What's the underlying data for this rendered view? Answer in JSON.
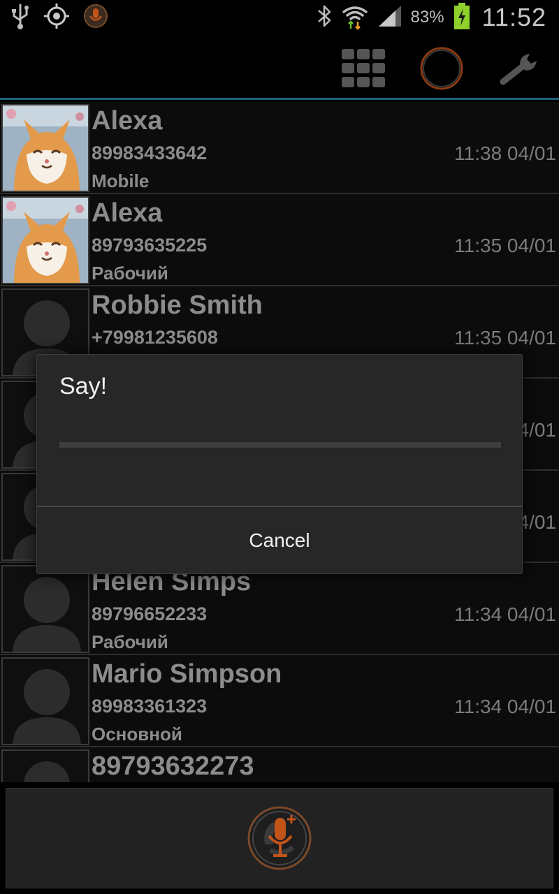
{
  "status_bar": {
    "battery_percent": "83%",
    "time": "11:52",
    "icons": [
      "usb-icon",
      "gps-icon",
      "app-notification-icon",
      "bluetooth-icon",
      "wifi-icon",
      "signal-icon",
      "battery-icon"
    ],
    "battery_level": 0.83
  },
  "action_bar": {
    "icons": [
      "dialpad-grid-icon",
      "ring-circle-icon",
      "wrench-settings-icon"
    ]
  },
  "calls": [
    {
      "name": "Alexa",
      "number": "89983433642",
      "time": "11:38 04/01",
      "type": "Mobile",
      "avatar": "cat-photo"
    },
    {
      "name": "Alexa",
      "number": "89793635225",
      "time": "11:35 04/01",
      "type": "Рабочий",
      "avatar": "cat-photo"
    },
    {
      "name": "Robbie Smith",
      "number": "+79981235608",
      "time": "11:35 04/01",
      "type": "",
      "avatar": "silhouette"
    },
    {
      "name": "",
      "number": "",
      "time": "4/01",
      "type": "",
      "avatar": "silhouette"
    },
    {
      "name": "",
      "number": "",
      "time": "4/01",
      "type": "",
      "avatar": "silhouette"
    },
    {
      "name": "Helen Simps",
      "number": "89796652233",
      "time": "11:34 04/01",
      "type": "Рабочий",
      "avatar": "silhouette"
    },
    {
      "name": "Mario Simpson",
      "number": "89983361323",
      "time": "11:34 04/01",
      "type": "Основной",
      "avatar": "silhouette"
    },
    {
      "name": "89793632273",
      "number": "",
      "time": "",
      "type": "",
      "avatar": "silhouette"
    }
  ],
  "dialog": {
    "title": "Say!",
    "cancel_label": "Cancel",
    "level": 0
  },
  "bottom": {
    "mic_icon": "voice-dial-mic-icon"
  },
  "colors": {
    "accent_orange": "#c2541a",
    "action_bar_divider": "#1f5f7e",
    "dialog_bg": "#272727"
  }
}
